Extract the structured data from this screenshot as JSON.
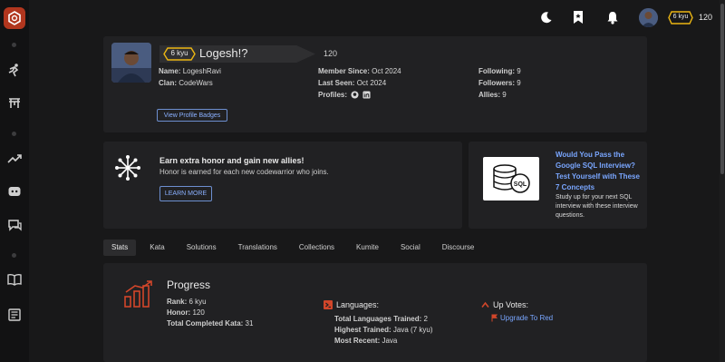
{
  "sidebar": {
    "items": [
      {
        "icon": "codewars-logo-icon"
      },
      {
        "icon": "kata-training-icon"
      },
      {
        "icon": "dojo-icon"
      },
      {
        "icon": "leaderboard-trend-icon"
      },
      {
        "icon": "discord-icon"
      },
      {
        "icon": "chat-icon"
      },
      {
        "icon": "docs-book-icon"
      },
      {
        "icon": "blog-icon"
      }
    ]
  },
  "topbar": {
    "rank": "6 kyu",
    "honor": "120"
  },
  "profile": {
    "rank": "6 kyu",
    "username": "Logesh!?",
    "honor": "120",
    "name_label": "Name:",
    "name_value": "LogeshRavi",
    "clan_label": "Clan:",
    "clan_value": "CodeWars",
    "member_since_label": "Member Since:",
    "member_since_value": "Oct 2024",
    "last_seen_label": "Last Seen:",
    "last_seen_value": "Oct 2024",
    "profiles_label": "Profiles:",
    "following_label": "Following:",
    "following_value": "9",
    "followers_label": "Followers:",
    "followers_value": "9",
    "allies_label": "Allies:",
    "allies_value": "9",
    "badges_button": "View Profile Badges"
  },
  "promo": {
    "title": "Earn extra honor and gain new allies!",
    "subtitle": "Honor is earned for each new codewarrior who joins.",
    "button": "LEARN MORE"
  },
  "ad": {
    "image_text": "SQL",
    "title": "Would You Pass the Google SQL Interview? Test Yourself with These 7 Concepts",
    "description": "Study up for your next SQL interview with these interview questions."
  },
  "tabs": [
    "Stats",
    "Kata",
    "Solutions",
    "Translations",
    "Collections",
    "Kumite",
    "Social",
    "Discourse"
  ],
  "stats": {
    "title": "Progress",
    "rank_label": "Rank:",
    "rank_value": "6 kyu",
    "honor_label": "Honor:",
    "honor_value": "120",
    "completed_label": "Total Completed Kata:",
    "completed_value": "31",
    "languages_head": "Languages:",
    "langs_trained_label": "Total Languages Trained:",
    "langs_trained_value": "2",
    "highest_label": "Highest Trained:",
    "highest_value": "Java (7 kyu)",
    "recent_label": "Most Recent:",
    "recent_value": "Java",
    "upvotes_head": "Up Votes:",
    "upgrade_link": "Upgrade To Red"
  },
  "colors": {
    "accent": "#b1361e",
    "link": "#79a6ff",
    "kyu_yellow": "#ecb613",
    "background": "#181819",
    "card": "#212123"
  }
}
